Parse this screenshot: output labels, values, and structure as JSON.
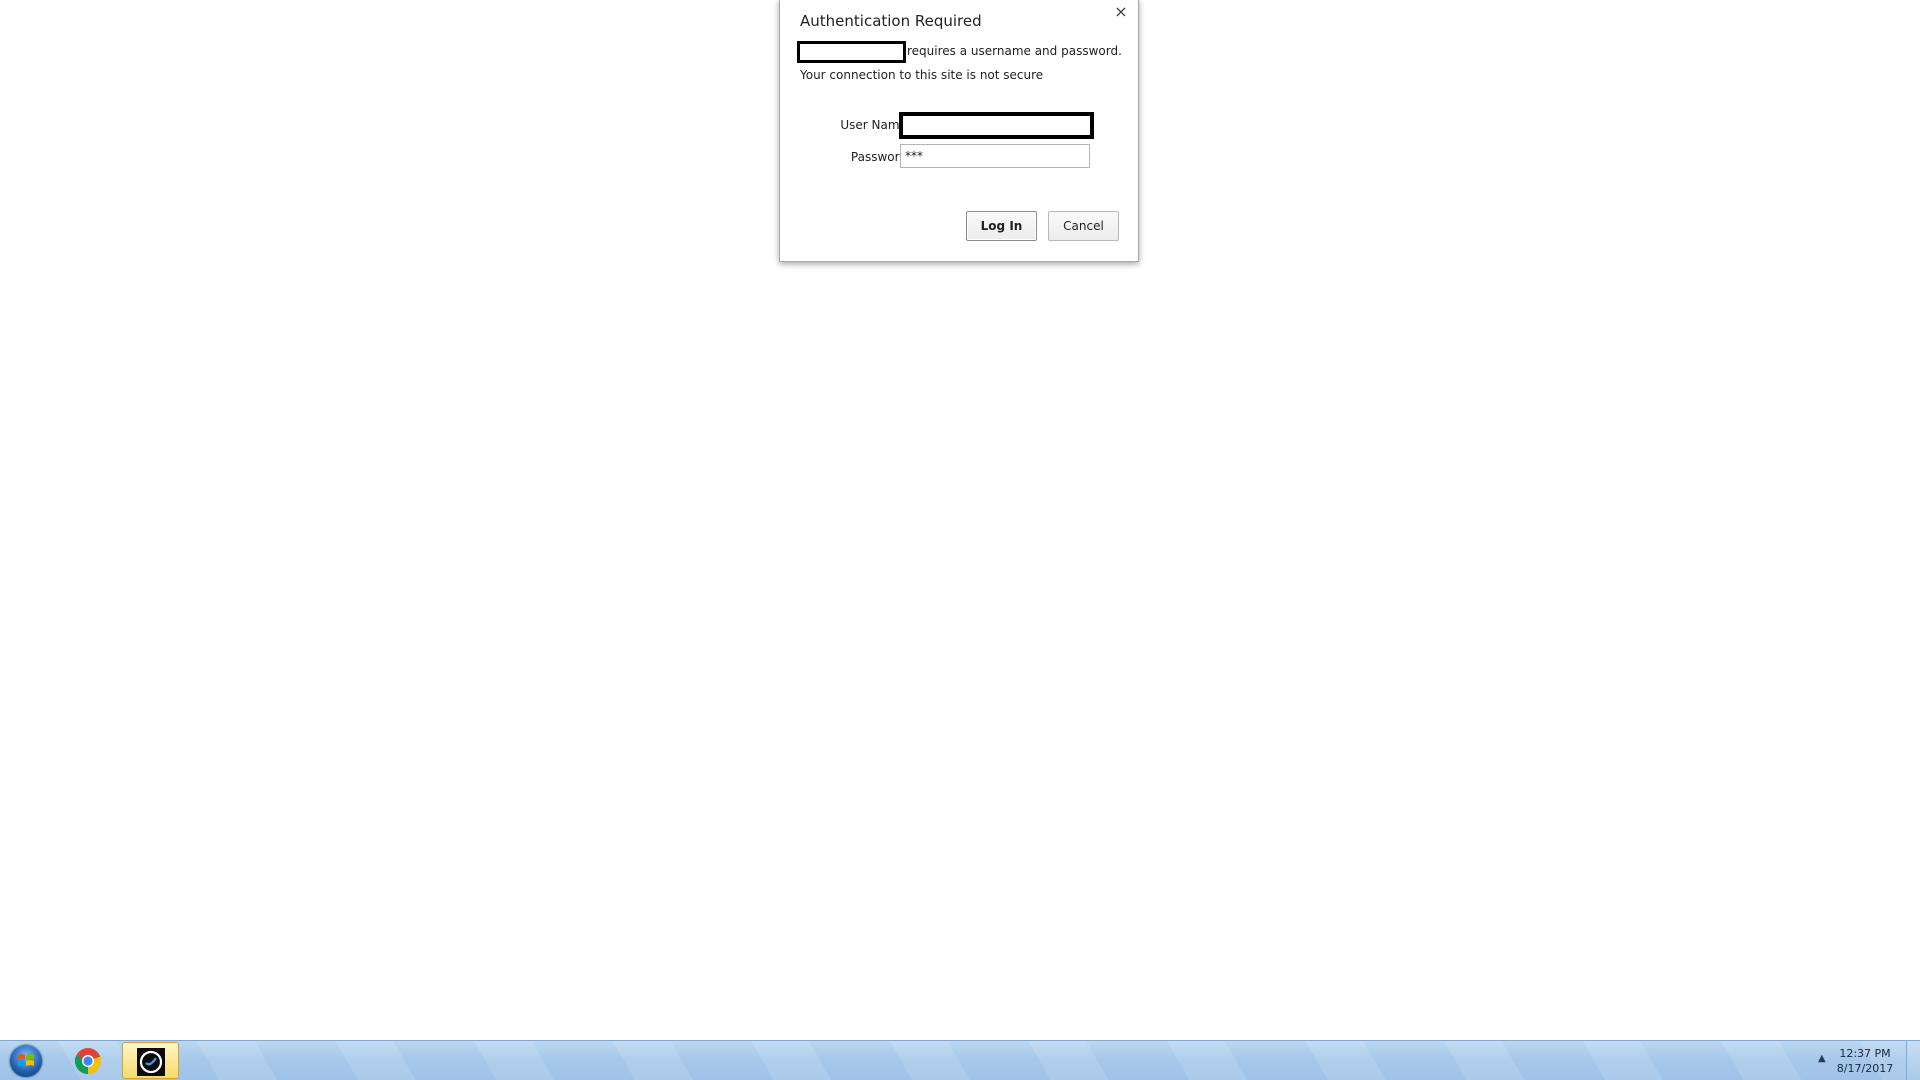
{
  "dialog": {
    "title": "Authentication Required",
    "close_glyph": "×",
    "message_suffix": "requires a username and password.",
    "insecure_notice": "Your connection to this site is not secure",
    "username_label": "User Name:",
    "username_value": "",
    "password_label": "Password:",
    "password_value": "***",
    "login_label": "Log In",
    "cancel_label": "Cancel"
  },
  "taskbar": {
    "apps": [
      {
        "icon": "windows-start-icon"
      },
      {
        "icon": "chrome-icon"
      },
      {
        "icon": "app-icon",
        "active": true
      }
    ],
    "tray_arrow": "▲",
    "clock": {
      "time": "12:37 PM",
      "date": "8/17/2017"
    }
  },
  "colors": {
    "taskbar": "#a6c8ea",
    "active_app": "#f8d96a",
    "redaction": "#000000"
  }
}
